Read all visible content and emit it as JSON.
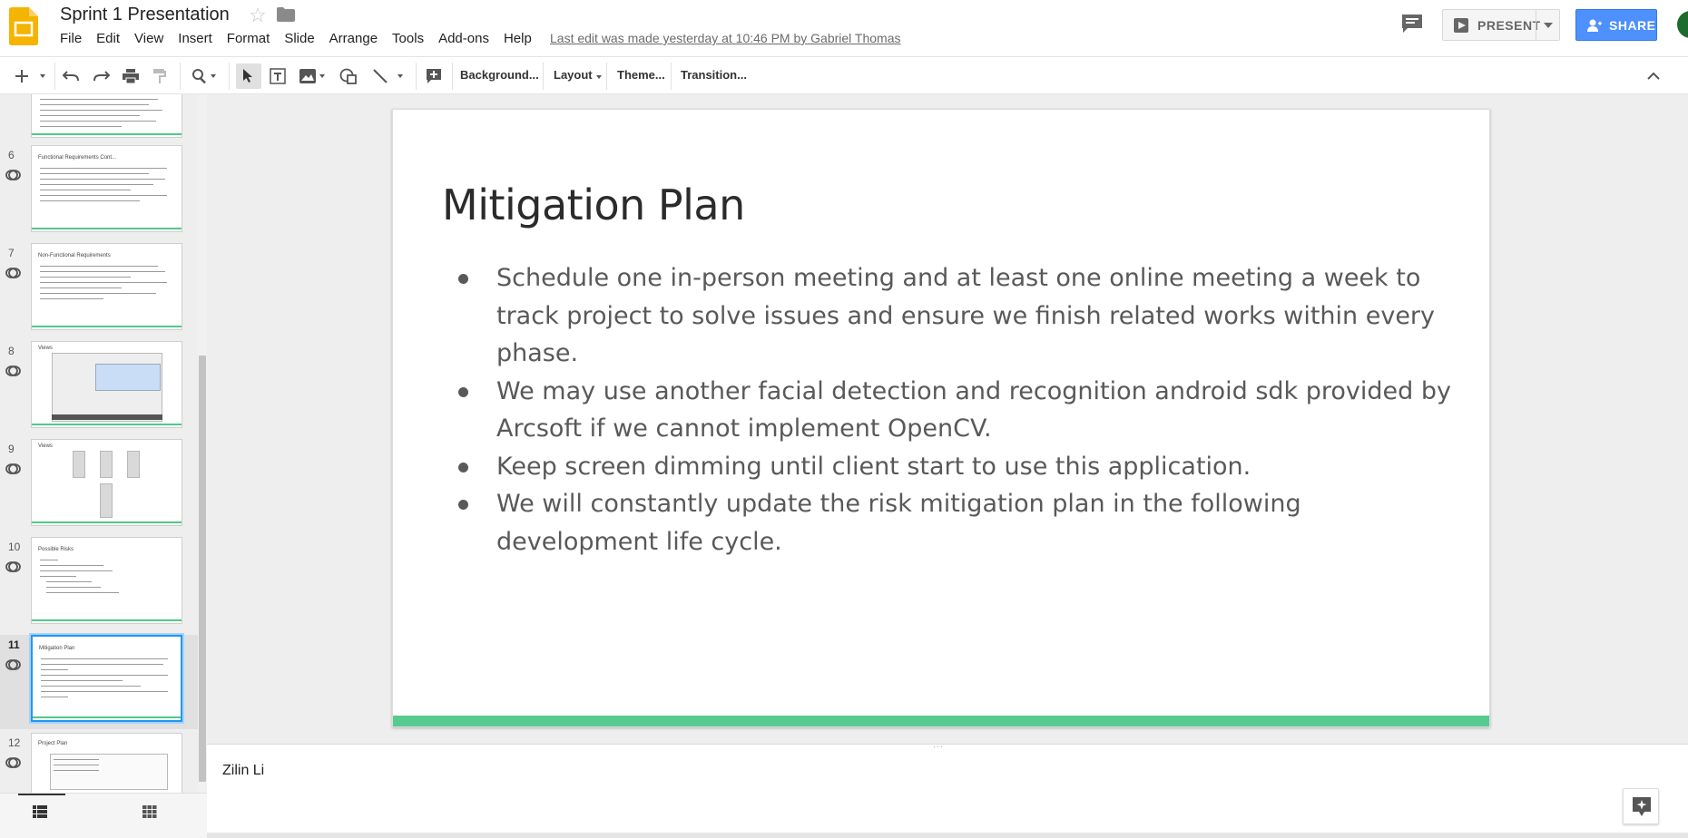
{
  "document": {
    "title": "Sprint 1 Presentation",
    "last_edit": "Last edit was made yesterday at 10:46 PM by Gabriel Thomas"
  },
  "menu": [
    "File",
    "Edit",
    "View",
    "Insert",
    "Format",
    "Slide",
    "Arrange",
    "Tools",
    "Add-ons",
    "Help"
  ],
  "header_buttons": {
    "present": "PRESENT",
    "share": "SHARE"
  },
  "toolbar": {
    "background": "Background...",
    "layout": "Layout",
    "theme": "Theme...",
    "transition": "Transition...",
    "icons": [
      "plus-icon",
      "undo-icon",
      "redo-icon",
      "print-icon",
      "paint-format-icon",
      "zoom-icon",
      "select-icon",
      "textbox-icon",
      "image-icon",
      "shape-icon",
      "line-icon",
      "new-comment-icon",
      "collapse-icon"
    ]
  },
  "filmstrip": {
    "slides": [
      {
        "number": "",
        "title": ""
      },
      {
        "number": "6",
        "title": "Functional Requirements Cont..."
      },
      {
        "number": "7",
        "title": "Non-Functional Requirements"
      },
      {
        "number": "8",
        "title": "Views"
      },
      {
        "number": "9",
        "title": "Views"
      },
      {
        "number": "10",
        "title": "Possible Risks"
      },
      {
        "number": "11",
        "title": "Mitigation Plan"
      },
      {
        "number": "12",
        "title": "Project Plan"
      }
    ],
    "active_slide": "11"
  },
  "slide": {
    "title": "Mitigation Plan",
    "bullets": [
      "Schedule one in-person meeting and at least one online meeting a week to track project to solve issues and ensure we finish related works within every phase.",
      "We may use another facial detection and recognition android sdk provided by Arcsoft if we cannot implement OpenCV.",
      "Keep screen dimming until client start to use this application.",
      "We will constantly update the risk mitigation plan in the following development life cycle."
    ],
    "accent_color": "#57cb8f"
  },
  "notes": {
    "text": "Zilin Li"
  },
  "colors": {
    "share_blue": "#4d90fe",
    "selection_blue": "#2196f3",
    "logo_yellow": "#f4b400"
  }
}
